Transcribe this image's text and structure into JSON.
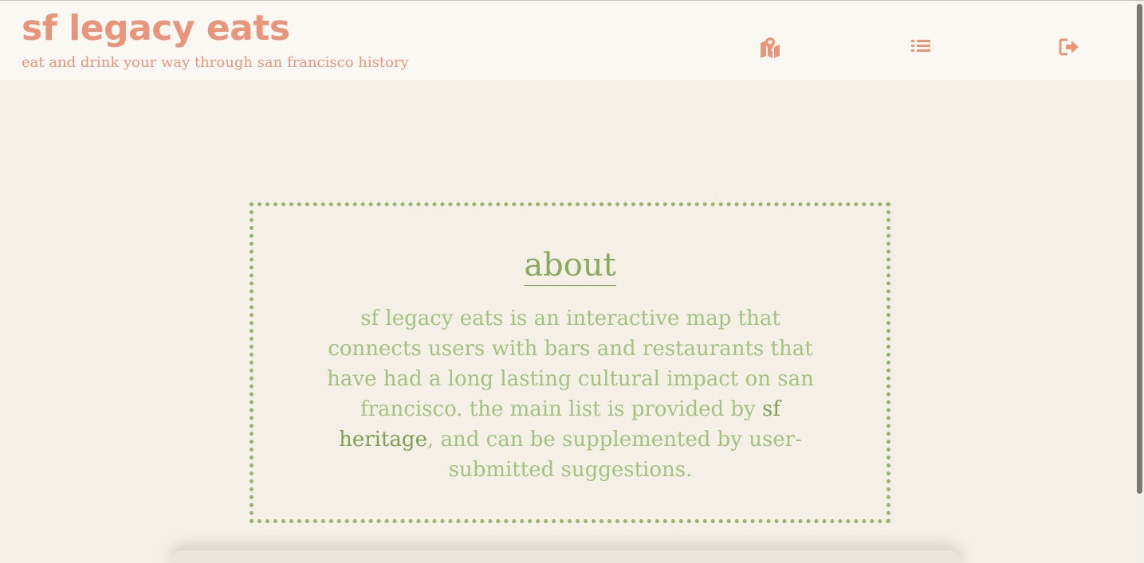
{
  "header": {
    "title": "sf legacy eats",
    "tagline": "eat and drink your way through san francisco history"
  },
  "nav": {
    "items": [
      {
        "icon": "map-icon"
      },
      {
        "icon": "list-icon"
      },
      {
        "icon": "sign-out-icon"
      }
    ]
  },
  "about": {
    "heading": "about",
    "text_before": "sf legacy eats is an interactive map that connects users with bars and restaurants that have had a long lasting cultural impact on san francisco. the main list is provided by ",
    "link_text": "sf heritage",
    "text_after": ", and can be supplemented by user-submitted suggestions."
  },
  "colors": {
    "brand": "#e8957c",
    "accent_green": "#98b46e",
    "text_green": "#a3c282",
    "background": "#f5f0e6",
    "header_bg": "#faf8f3"
  }
}
